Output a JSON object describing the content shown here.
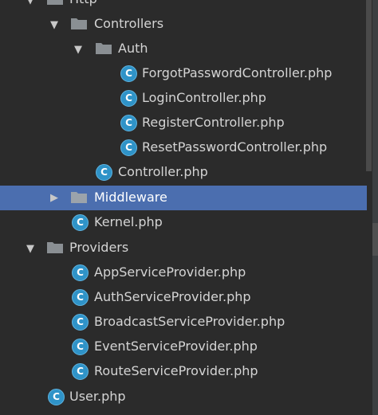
{
  "tree": {
    "items": [
      {
        "label": "Http",
        "kind": "folder",
        "expanded": true,
        "depth": 1
      },
      {
        "label": "Controllers",
        "kind": "folder",
        "expanded": true,
        "depth": 2
      },
      {
        "label": "Auth",
        "kind": "folder",
        "expanded": true,
        "depth": 3
      },
      {
        "label": "ForgotPasswordController.php",
        "kind": "class",
        "depth": 4
      },
      {
        "label": "LoginController.php",
        "kind": "class",
        "depth": 4
      },
      {
        "label": "RegisterController.php",
        "kind": "class",
        "depth": 4
      },
      {
        "label": "ResetPasswordController.php",
        "kind": "class",
        "depth": 4
      },
      {
        "label": "Controller.php",
        "kind": "class",
        "depth": 3
      },
      {
        "label": "Middleware",
        "kind": "folder",
        "expanded": false,
        "selected": true,
        "depth": 2
      },
      {
        "label": "Kernel.php",
        "kind": "class",
        "depth": 2
      },
      {
        "label": "Providers",
        "kind": "folder",
        "expanded": true,
        "depth": 1
      },
      {
        "label": "AppServiceProvider.php",
        "kind": "class",
        "depth": 2
      },
      {
        "label": "AuthServiceProvider.php",
        "kind": "class",
        "depth": 2
      },
      {
        "label": "BroadcastServiceProvider.php",
        "kind": "class",
        "depth": 2
      },
      {
        "label": "EventServiceProvider.php",
        "kind": "class",
        "depth": 2
      },
      {
        "label": "RouteServiceProvider.php",
        "kind": "class",
        "depth": 2
      },
      {
        "label": "User.php",
        "kind": "class",
        "depth": 1
      }
    ],
    "class_icon_letter": "C"
  },
  "colors": {
    "background": "#2b2b2b",
    "selection": "#4b6eaf",
    "class_icon": "#2f93c8",
    "folder": "#8a8f93",
    "text": "#d4d4d4"
  },
  "icons": {
    "expanded": "triangle-down-icon",
    "collapsed": "triangle-right-icon",
    "folder": "folder-icon",
    "class": "php-class-icon"
  }
}
